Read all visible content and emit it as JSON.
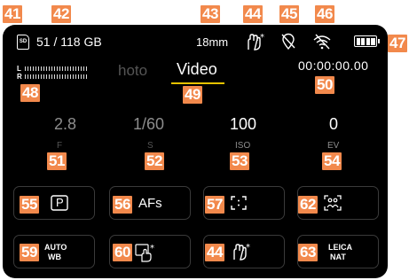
{
  "status_bar": {
    "storage": "51 / 118 GB",
    "sd_label": "SD",
    "focal_length": "18mm",
    "battery_level": 1.0
  },
  "audio": {
    "left_label": "L",
    "right_label": "R"
  },
  "tabs": {
    "photo": "hoto",
    "video": "Video"
  },
  "timecode": "00:00:00.00",
  "exposure": [
    {
      "value": "2.8",
      "label": "F"
    },
    {
      "value": "1/60",
      "label": "S"
    },
    {
      "value": "100",
      "label": "ISO"
    },
    {
      "value": "0",
      "label": "EV"
    }
  ],
  "tiles": {
    "exposure_mode": "P",
    "focus_mode": "AFs",
    "white_balance_top": "AUTO",
    "white_balance_bottom": "WB",
    "film_style_top": "LEICA",
    "film_style_bottom": "NAT"
  },
  "callouts": {
    "c41": "41",
    "c42": "42",
    "c43": "43",
    "c44": "44",
    "c45": "45",
    "c46": "46",
    "c47": "47",
    "c48": "48",
    "c49": "49",
    "c50": "50",
    "c51": "51",
    "c52": "52",
    "c53": "53",
    "c54": "54",
    "c55": "55",
    "c56": "56",
    "c57": "57",
    "c62": "62",
    "c59": "59",
    "c60": "60",
    "c44b": "44",
    "c63": "63"
  },
  "colors": {
    "callout_bg": "#f2894c",
    "screen_bg": "#000000",
    "tab_underline": "#e6c200",
    "tile_border": "#3a3a3a"
  }
}
